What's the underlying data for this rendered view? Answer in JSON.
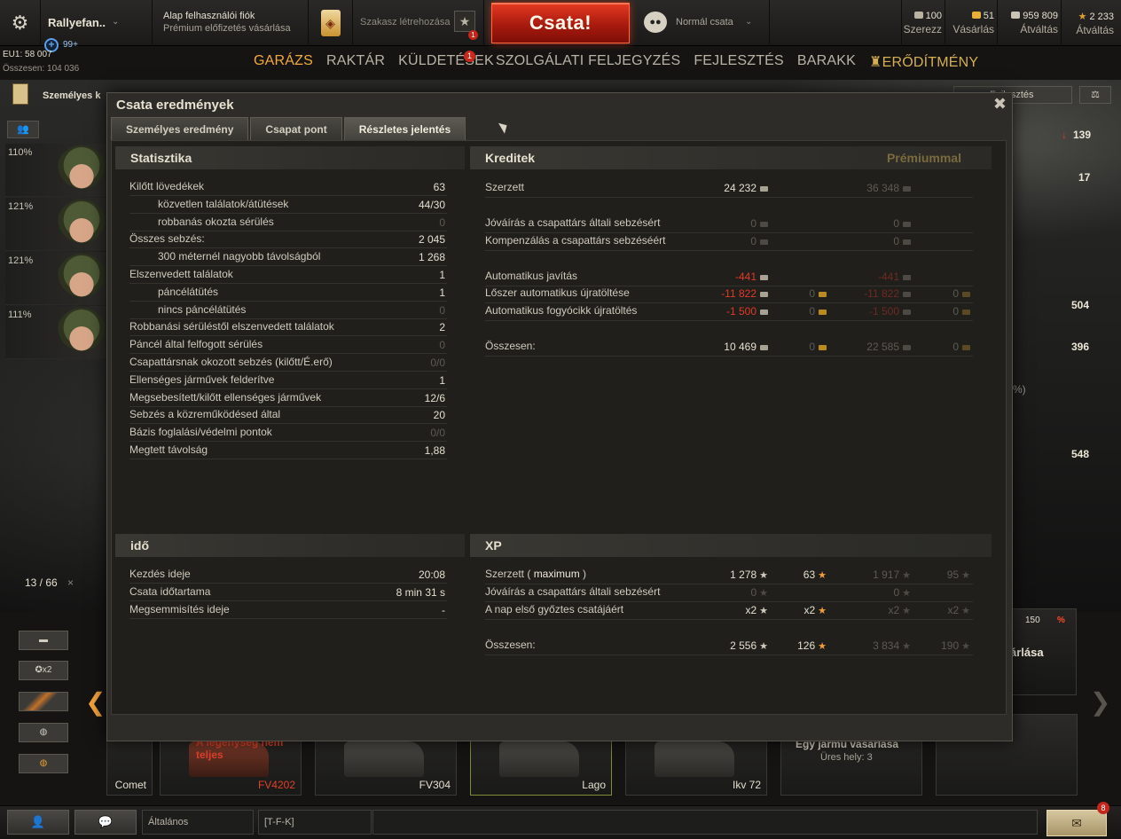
{
  "topbar": {
    "player_name": "Rallyefan..",
    "invite_count": "99+",
    "account_title": "Alap felhasználói fiók",
    "account_sub": "Prémium előfizetés vásárlása",
    "squad_label": "Szakasz létrehozása",
    "squad_badge": "1",
    "battle_button": "Csata!",
    "battle_mode": "Normál csata",
    "resources": [
      {
        "value": "100",
        "label": "Szerezz",
        "icon": "bonds-icon",
        "color": "#b9b3a2"
      },
      {
        "value": "51",
        "label": "Vásárlás",
        "icon": "gold-icon",
        "color": "#e8b03a"
      },
      {
        "value": "959 809",
        "label": "Átváltás",
        "icon": "credits-icon",
        "color": "#c9c4b6"
      },
      {
        "value": "2 233",
        "label": "Átváltás",
        "icon": "free-xp-icon",
        "color": "#e0a030"
      }
    ]
  },
  "server": {
    "eu_line": "EU1: 58 007",
    "total_line": "Összesen: 104 036"
  },
  "nav": {
    "items": [
      "GARÁZS",
      "RAKTÁR",
      "KÜLDETÉSEK",
      "SZOLGÁLATI FELJEGYZÉS",
      "FEJLESZTÉS",
      "BARAKK",
      "ERŐDÍTMÉNY"
    ],
    "missions_badge": "1"
  },
  "left": {
    "personal_label": "Személyes k",
    "crew": [
      "110%",
      "121%",
      "121%",
      "111%"
    ],
    "counter": "13 / 66",
    "filter_x2": "x2"
  },
  "right": {
    "research_button": "Fejlesztés",
    "values": [
      "139",
      "17",
      "504",
      "396",
      "548"
    ],
    "percent_fragment": "%)",
    "offer_price": "150",
    "offer_percent": "%",
    "offer_text": "árlása"
  },
  "carousel": [
    {
      "name": "Comet",
      "red": false
    },
    {
      "name": "FV4202",
      "red": true,
      "warning": "A legénység nem teljes"
    },
    {
      "name": "FV304",
      "red": false
    },
    {
      "name": "Lago",
      "red": false
    },
    {
      "name": "Ikv 72",
      "red": false
    }
  ],
  "buy_slot": {
    "title": "Egy jármű vásárlása",
    "sub": "Üres hely: 3"
  },
  "bottombar": {
    "channel": "Általános",
    "clan": "[T-F-K]",
    "notif_count": "8"
  },
  "dialog": {
    "title": "Csata eredmények",
    "tabs": [
      "Személyes eredmény",
      "Csapat pont",
      "Részletes jelentés"
    ],
    "stats_head": "Statisztika",
    "stats": [
      {
        "label": "Kilőtt lövedékek",
        "value": "63",
        "indent": false,
        "dim": false
      },
      {
        "label": "közvetlen találatok/átütések",
        "value": "44/30",
        "indent": true,
        "dim": false
      },
      {
        "label": "robbanás okozta sérülés",
        "value": "0",
        "indent": true,
        "dim": true
      },
      {
        "label": "Összes sebzés:",
        "value": "2 045",
        "indent": false,
        "dim": false
      },
      {
        "label": "300 méternél nagyobb távolságból",
        "value": "1 268",
        "indent": true,
        "dim": false
      },
      {
        "label": "Elszenvedett találatok",
        "value": "1",
        "indent": false,
        "dim": false
      },
      {
        "label": "páncélátütés",
        "value": "1",
        "indent": true,
        "dim": false
      },
      {
        "label": "nincs páncélátütés",
        "value": "0",
        "indent": true,
        "dim": true
      },
      {
        "label": "Robbanási sérüléstől elszenvedett találatok",
        "value": "2",
        "indent": false,
        "dim": false
      },
      {
        "label": "Páncél által felfogott sérülés",
        "value": "0",
        "indent": false,
        "dim": true
      },
      {
        "label": "Csapattársnak okozott sebzés (kilőtt/É.erő)",
        "value": "0/0",
        "indent": false,
        "dim": true
      },
      {
        "label": "Ellenséges járművek felderítve",
        "value": "1",
        "indent": false,
        "dim": false
      },
      {
        "label": "Megsebesített/kilőtt ellenséges járművek",
        "value": "12/6",
        "indent": false,
        "dim": false
      },
      {
        "label": "Sebzés a közreműködésed által",
        "value": "20",
        "indent": false,
        "dim": false
      },
      {
        "label": "Bázis foglalási/védelmi pontok",
        "value": "0/0",
        "indent": false,
        "dim": true
      },
      {
        "label": "Megtett távolság",
        "value": "1,88",
        "indent": false,
        "dim": false
      }
    ],
    "credits_head": "Kreditek",
    "premium_head": "Prémiummal",
    "credits": [
      {
        "label": "Szerzett",
        "base": "24 232",
        "base_gold": "",
        "prem": "36 348",
        "prem_gold": "",
        "red": false,
        "dim": false
      },
      {
        "label": "Jóváírás a csapattárs általi sebzésért",
        "base": "0",
        "base_gold": "",
        "prem": "0",
        "prem_gold": "",
        "red": false,
        "dim": true
      },
      {
        "label": "Kompenzálás a csapattárs sebzéséért",
        "base": "0",
        "base_gold": "",
        "prem": "0",
        "prem_gold": "",
        "red": false,
        "dim": true
      },
      {
        "label": "Automatikus javítás",
        "base": "-441",
        "base_gold": "",
        "prem": "-441",
        "prem_gold": "",
        "red": true,
        "dim": false
      },
      {
        "label": "Lőszer automatikus újratöltése",
        "base": "-11 822",
        "base_gold": "0",
        "prem": "-11 822",
        "prem_gold": "0",
        "red": true,
        "dim": false
      },
      {
        "label": "Automatikus fogyócikk újratöltés",
        "base": "-1 500",
        "base_gold": "0",
        "prem": "-1 500",
        "prem_gold": "0",
        "red": true,
        "dim": false
      },
      {
        "label": "Összesen:",
        "base": "10 469",
        "base_gold": "0",
        "prem": "22 585",
        "prem_gold": "0",
        "red": false,
        "dim": false
      }
    ],
    "time_head": "idő",
    "time": [
      {
        "label": "Kezdés ideje",
        "value": "20:08"
      },
      {
        "label": "Csata időtartama",
        "value": "8 min 31 s"
      },
      {
        "label": "Megsemmisítés ideje",
        "value": "-"
      }
    ],
    "xp_head": "XP",
    "xp": [
      {
        "label": "Szerzett",
        "label_extra": "maximum",
        "xp": "1 278",
        "fxp": "63",
        "pxp": "1 917",
        "pfxp": "95"
      },
      {
        "label": "Jóváírás a csapattárs általi sebzésért",
        "label_extra": "",
        "xp": "0",
        "fxp": "",
        "pxp": "0",
        "pfxp": ""
      },
      {
        "label": "A nap első győztes csatájáért",
        "label_extra": "",
        "xp": "x2",
        "fxp": "x2",
        "pxp": "x2",
        "pfxp": "x2"
      },
      {
        "label": "Összesen:",
        "label_extra": "",
        "xp": "2 556",
        "fxp": "126",
        "pxp": "3 834",
        "pfxp": "190"
      }
    ]
  }
}
